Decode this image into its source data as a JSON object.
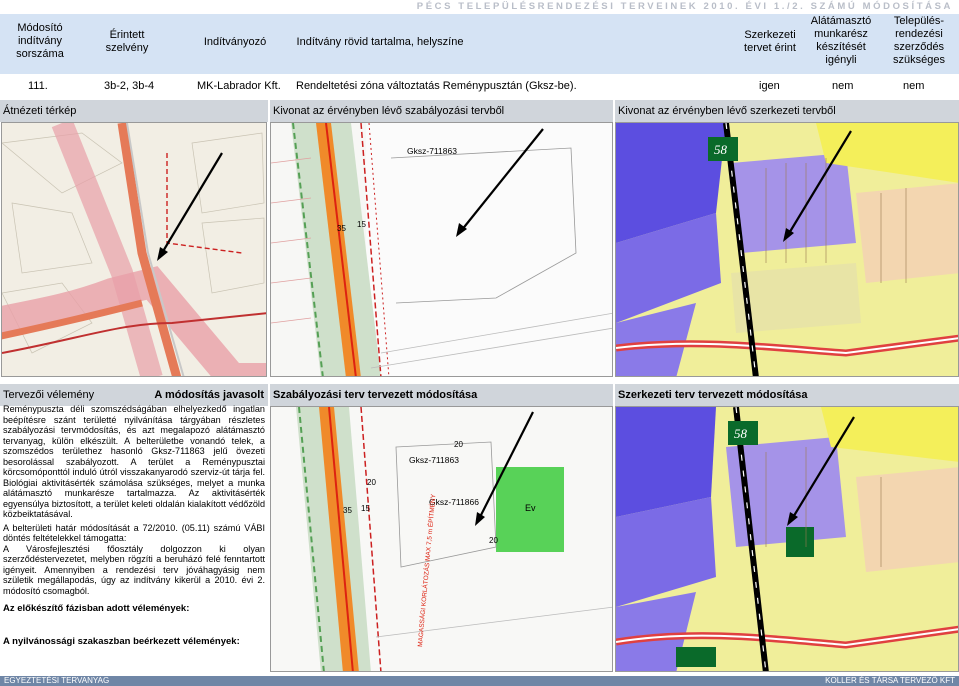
{
  "doc_title": "PÉCS TELEPÜLÉSRENDEZÉSI TERVEINEK 2010. ÉVI 1./2. SZÁMÚ MÓDOSÍTÁSA",
  "header": {
    "col1": "Módosító indítvány sorszáma",
    "col2": "Érintett szelvény",
    "col3": "Indítványozó",
    "col4": "Indítvány rövid tartalma, helyszíne",
    "col5": "Szerkezeti tervet érint",
    "col6": "Alátámasztó munkarész készítését igényli",
    "col7": "Település-rendezési szerződés szükséges"
  },
  "row": {
    "num": "111.",
    "sheet": "3b-2, 3b-4",
    "applicant": "MK-Labrador Kft.",
    "content": "Rendeltetési zóna változtatás Reménypusztán (Gksz-be).",
    "structural": "igen",
    "supporting": "nem",
    "contract": "nem"
  },
  "sections": {
    "overview_map": "Átnézeti térkép",
    "regulation_extract": "Kivonat az érvényben lévő szabályozási tervből",
    "structural_extract": "Kivonat az érvényben lévő szerkezeti tervből",
    "designer_opinion": "Tervezői vélemény",
    "recommendation": "A módosítás javasolt",
    "regulation_proposed": "Szabályozási terv tervezett módosítása",
    "structural_proposed": "Szerkezeti terv tervezett módosítása"
  },
  "map_labels": {
    "zone_current": "Gksz-711863",
    "zone_new": "Gksz-711866",
    "green_zone": "Ev",
    "num_58": "58",
    "num_35": "35",
    "num_15": "15",
    "num_20": "20",
    "height_limit": "MAGASSÁGI KORLÁTOZÁS MAX 7,5 m ÉPÍTMÉNY"
  },
  "opinion": {
    "p1": "Reménypuszta déli szomszédságában elhelyezkedő ingatlan beépítésre szánt területté nyilvánítása tárgyában részletes szabályozási tervmódosítás, és azt megalapozó alátámasztó tervanyag, külön elkészült. A belterületbe vonandó telek, a szomszédos területhez hasonló Gksz-711863 jelű övezeti besorolással szabályozott. A terület a Reménypusztai körcsomóponttól induló útról visszakanyarodó szerviz-út tárja fel. Biológiai aktivitásérték számolása szükséges, melyet a munka alátámasztó munkarésze tartalmazza. Az aktivitásérték egyensúlya biztosított, a terület keleti oldalán kialakított védőzöld közbeiktatásával.",
    "p2": "A belterületi határ módosítását a 72/2010. (05.11) számú VÁBI döntés feltételekkel támogatta:",
    "p3": "A Városfejlesztési főosztály dolgozzon ki olyan szerződéstervezetet, melyben rögzíti a beruházó felé fenntartott igényeit. Amennyiben a rendezési terv jóváhagyásig nem születik megállapodás, úgy az indítvány kikerül a 2010. évi 2. módosító csomagból.",
    "prelim_title": "Az előkészítő fázisban adott vélemények:",
    "public_title": "A nyilvánossági szakaszban beérkezett vélemények:"
  },
  "footer": {
    "left": "EGYEZTETÉSI TERVANYAG",
    "right": "KOLLER ÉS TÁRSA TERVEZŐ KFT"
  }
}
